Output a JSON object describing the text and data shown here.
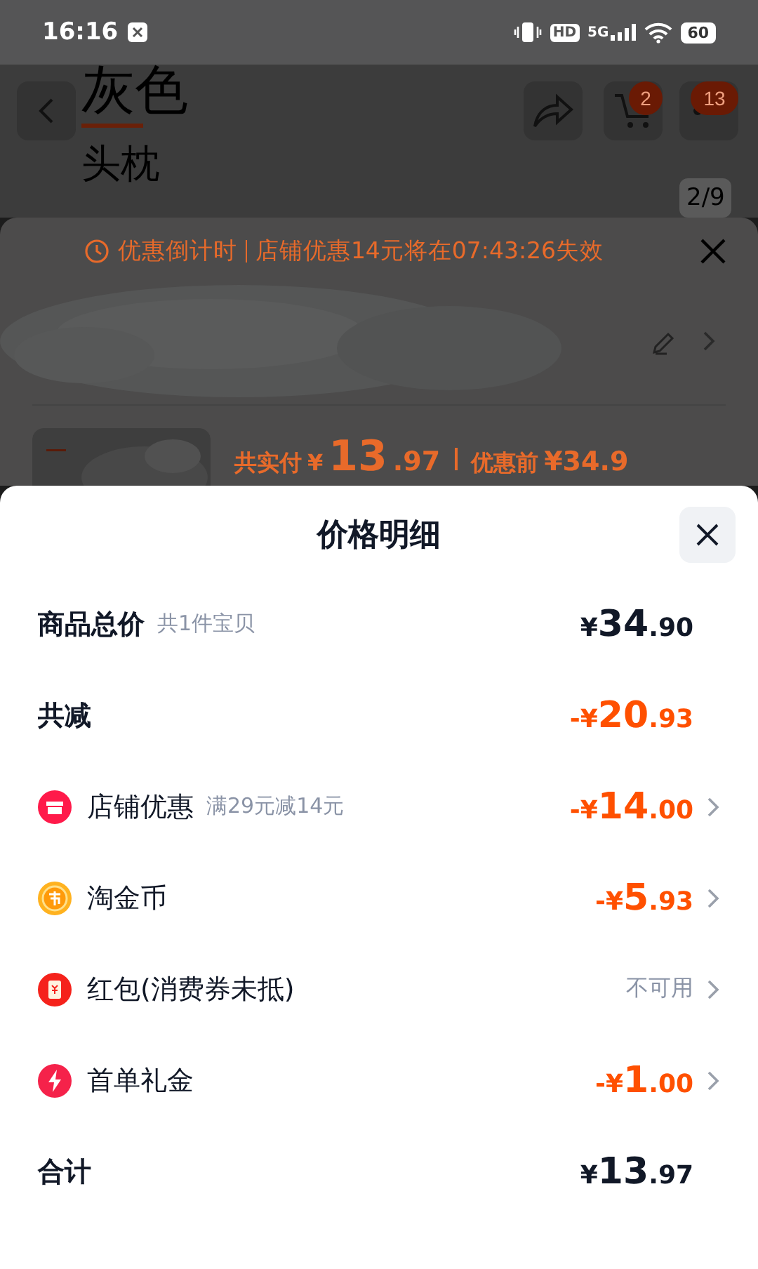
{
  "status_bar": {
    "time": "16:16",
    "hd": "HD",
    "network": "5G",
    "battery": "60"
  },
  "product_page": {
    "color_tab": "灰色",
    "item_tab": "头枕",
    "cart_count": "2",
    "more_count": "13",
    "image_counter": "2/9"
  },
  "order_sheet": {
    "countdown_label": "优惠倒计时",
    "countdown_text": "店铺优惠14元将在07:43:26失效",
    "pay_label": "共实付",
    "pay_amount": {
      "prefix": "¥",
      "integer": "13",
      "decimal": ".97"
    },
    "before_label": "优惠前",
    "before_amount": "¥34.9"
  },
  "price_sheet": {
    "title": "价格明细",
    "rows": [
      {
        "kind": "sum",
        "label": "商品总价",
        "note": "共1件宝贝",
        "arrow": false,
        "amount": {
          "prefix": "¥",
          "integer": "34",
          "decimal": ".90"
        }
      },
      {
        "kind": "reduction",
        "label": "共减",
        "arrow": false,
        "amount": {
          "prefix": "-¥",
          "integer": "20",
          "decimal": ".93"
        }
      },
      {
        "kind": "shop",
        "label": "店铺优惠",
        "note": "满29元减14元",
        "arrow": true,
        "amount": {
          "prefix": "-¥",
          "integer": "14",
          "decimal": ".00"
        }
      },
      {
        "kind": "coin",
        "label": "淘金币",
        "arrow": true,
        "amount": {
          "prefix": "-¥",
          "integer": "5",
          "decimal": ".93"
        }
      },
      {
        "kind": "voucher",
        "label": "红包(消费券未抵)",
        "arrow": true,
        "status": "不可用"
      },
      {
        "kind": "bolt",
        "label": "首单礼金",
        "arrow": true,
        "amount": {
          "prefix": "-¥",
          "integer": "1",
          "decimal": ".00"
        }
      },
      {
        "kind": "sum",
        "label": "合计",
        "arrow": false,
        "amount": {
          "prefix": "¥",
          "integer": "13",
          "decimal": ".97"
        }
      }
    ]
  }
}
